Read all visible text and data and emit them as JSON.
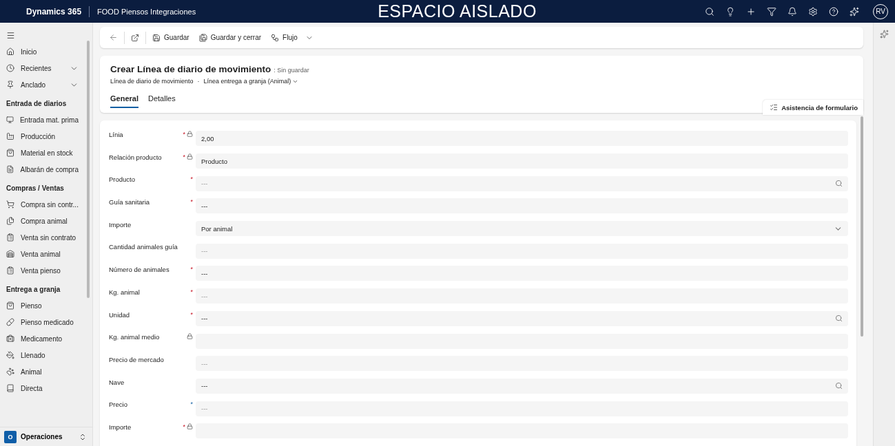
{
  "top_bar": {
    "app_name": "Dynamics 365",
    "environment": "FOOD Piensos Integraciones",
    "banner": "ESPACIO AISLADO",
    "avatar": "RV"
  },
  "sidebar": {
    "items": [
      {
        "label": "Inicio",
        "expandable": false
      },
      {
        "label": "Recientes",
        "expandable": true
      },
      {
        "label": "Anclado",
        "expandable": true
      }
    ],
    "groups": [
      {
        "title": "Entrada de diarios",
        "items": [
          {
            "label": "Entrada mat. prima"
          },
          {
            "label": "Producción"
          },
          {
            "label": "Material en stock"
          },
          {
            "label": "Albarán de compra"
          }
        ]
      },
      {
        "title": "Compras / Ventas",
        "items": [
          {
            "label": "Compra sin contr..."
          },
          {
            "label": "Compra animal"
          },
          {
            "label": "Venta sin contrato"
          },
          {
            "label": "Venta animal"
          },
          {
            "label": "Venta pienso"
          }
        ]
      },
      {
        "title": "Entrega a granja",
        "items": [
          {
            "label": "Pienso"
          },
          {
            "label": "Pienso medicado"
          },
          {
            "label": "Medicamento"
          },
          {
            "label": "Llenado"
          },
          {
            "label": "Animal"
          },
          {
            "label": "Directa"
          }
        ]
      }
    ],
    "area": {
      "badge": "O",
      "label": "Operaciones"
    }
  },
  "toolbar": {
    "buttons": [
      {
        "label": "Guardar",
        "dropdown": false
      },
      {
        "label": "Guardar y cerrar",
        "dropdown": false
      },
      {
        "label": "Flujo",
        "dropdown": true
      }
    ]
  },
  "header": {
    "title": "Crear Línea de diario de movimiento",
    "status": ": Sin guardar",
    "entity": "Línea de diario de movimiento",
    "separator": "·",
    "form": "Línea entrega a granja (Animal)",
    "tabs": [
      {
        "label": "General",
        "selected": true
      },
      {
        "label": "Detalles",
        "selected": false
      }
    ],
    "assist": "Asistencia de formulario"
  },
  "fields": [
    {
      "label": "Línia",
      "asterisk": "*",
      "recommended": false,
      "locked": true,
      "kind": "text",
      "value": "2,00"
    },
    {
      "label": "Relación producto",
      "asterisk": "*",
      "recommended": false,
      "locked": true,
      "kind": "text",
      "value": "Producto"
    },
    {
      "label": "Producto",
      "asterisk": "*",
      "recommended": false,
      "locked": false,
      "kind": "lookup",
      "placeholder": "---"
    },
    {
      "label": "Guía sanitaria",
      "asterisk": "*",
      "recommended": false,
      "locked": false,
      "kind": "text",
      "value": "---"
    },
    {
      "label": "Importe",
      "locked": false,
      "kind": "select",
      "value": "Por animal"
    },
    {
      "label": "Cantidad animales guía",
      "locked": false,
      "kind": "text",
      "placeholder": "---"
    },
    {
      "label": "Número de animales",
      "asterisk": "*",
      "recommended": false,
      "locked": false,
      "kind": "text",
      "value": "---"
    },
    {
      "label": "Kg. animal",
      "asterisk": "*",
      "recommended": false,
      "locked": false,
      "kind": "text",
      "placeholder": "---"
    },
    {
      "label": "Unidad",
      "asterisk": "*",
      "recommended": false,
      "locked": false,
      "kind": "lookup",
      "value": "---"
    },
    {
      "label": "Kg. animal medio",
      "locked": true,
      "kind": "text"
    },
    {
      "label": "Precio de mercado",
      "locked": false,
      "kind": "text",
      "placeholder": "---"
    },
    {
      "label": "Nave",
      "locked": false,
      "kind": "lookup",
      "value": "---"
    },
    {
      "label": "Precio",
      "asterisk": "*",
      "recommended": true,
      "locked": false,
      "kind": "text",
      "placeholder": "---"
    },
    {
      "label": "Importe",
      "asterisk": "*",
      "recommended": false,
      "locked": true,
      "kind": "text"
    }
  ]
}
